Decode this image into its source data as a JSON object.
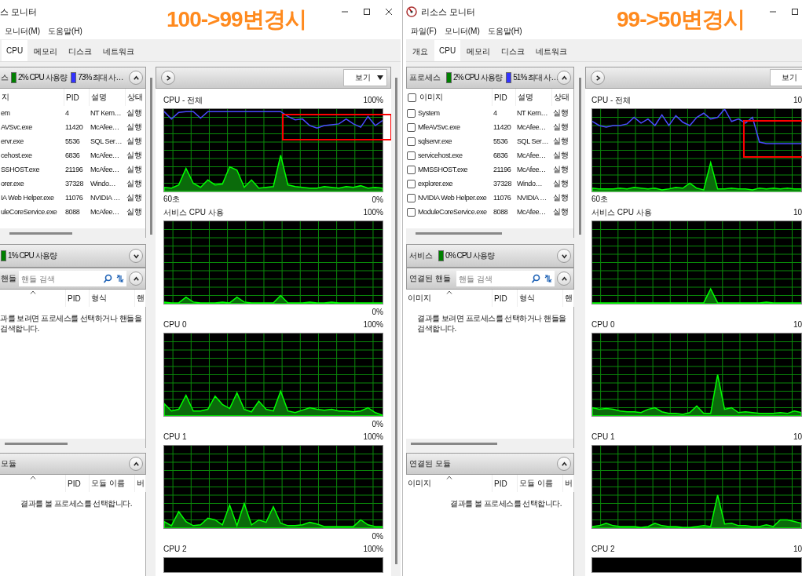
{
  "windows": [
    {
      "title": "스 모니터",
      "annotation": "100->99변경시",
      "menu": [
        "모니터(M)",
        "도움말(H)"
      ],
      "tabs": [
        {
          "label": "CPU",
          "selected": true
        },
        {
          "label": "메모리",
          "selected": false
        },
        {
          "label": "디스크",
          "selected": false
        },
        {
          "label": "네트워크",
          "selected": false
        }
      ],
      "processes": {
        "title": "스",
        "expanded": true,
        "legends": [
          {
            "text": "2% CPU 사용량",
            "color": "#008000"
          },
          {
            "text": "73% 최대 사…",
            "color": "#3333ff"
          }
        ],
        "columns": [
          {
            "label": "지"
          },
          {
            "label": "PID"
          },
          {
            "label": "설명"
          },
          {
            "label": "상태"
          }
        ],
        "rows": [
          {
            "image": "em",
            "pid": "4",
            "description": "NT Kern…",
            "status": "실행"
          },
          {
            "image": "AVSvc.exe",
            "pid": "11420",
            "description": "McAfee…",
            "status": "실행"
          },
          {
            "image": "ervr.exe",
            "pid": "5536",
            "description": "SQL Ser…",
            "status": "실행"
          },
          {
            "image": "cehost.exe",
            "pid": "6836",
            "description": "McAfee…",
            "status": "실행"
          },
          {
            "image": "SSHOST.exe",
            "pid": "21196",
            "description": "McAfee…",
            "status": "실행"
          },
          {
            "image": "orer.exe",
            "pid": "37328",
            "description": "Windo…",
            "status": "실행"
          },
          {
            "image": "IA Web Helper.exe",
            "pid": "11076",
            "description": "NVIDIA …",
            "status": "실행"
          },
          {
            "image": "uleCoreService.exe",
            "pid": "8088",
            "description": "McAfee…",
            "status": "실행"
          }
        ]
      },
      "services": {
        "expanded": false,
        "legends": [
          {
            "text": "1% CPU 사용량",
            "color": "#008000"
          }
        ]
      },
      "handles": {
        "title": "핸들",
        "expanded": true,
        "search_placeholder": "핸들 검색",
        "columns": [
          {
            "sorted": true
          },
          {
            "label": "PID",
            "sorted": false
          },
          {
            "label": "형식",
            "sorted": false
          },
          {
            "label": "핸",
            "sorted": false
          }
        ],
        "message": "과를 보려면 프로세스를 선택하거나 핸들을 검색합니다."
      },
      "modules": {
        "title": "모듈",
        "expanded": true,
        "columns": [
          {
            "sorted": true
          },
          {
            "label": "PID",
            "sorted": false
          },
          {
            "label": "모듈 이름",
            "sorted": false
          },
          {
            "label": "버",
            "sorted": false
          }
        ],
        "message": "결과를 볼 프로세스를 선택합니다."
      },
      "view_button": "보기",
      "graphs": [
        {
          "title": "CPU - 전체",
          "top_label": "100%",
          "left_label": "60초",
          "bottom_label": "0%",
          "highlight": true
        },
        {
          "title": "서비스 CPU 사용",
          "top_label": "100%",
          "bottom_label": "0%"
        },
        {
          "title": "CPU 0",
          "top_label": "100%",
          "bottom_label": "0%"
        },
        {
          "title": "CPU 1",
          "top_label": "100%",
          "bottom_label": "0%"
        },
        {
          "title": "CPU 2",
          "top_label": "100%"
        }
      ]
    },
    {
      "title": "리소스 모니터",
      "annotation": "99->50변경시",
      "menu": [
        "파일(F)",
        "모니터(M)",
        "도움말(H)"
      ],
      "tabs": [
        {
          "label": "개요",
          "selected": false
        },
        {
          "label": "CPU",
          "selected": true
        },
        {
          "label": "메모리",
          "selected": false
        },
        {
          "label": "디스크",
          "selected": false
        },
        {
          "label": "네트워크",
          "selected": false
        }
      ],
      "processes": {
        "title": "프로세스",
        "expanded": true,
        "select_all_checked": false,
        "legends": [
          {
            "text": "2% CPU 사용량",
            "color": "#008000"
          },
          {
            "text": "51% 최대 사…",
            "color": "#3333ff"
          }
        ],
        "columns": [
          {
            "label": "이미지"
          },
          {
            "label": "PID"
          },
          {
            "label": "설명"
          },
          {
            "label": "상태"
          }
        ],
        "rows": [
          {
            "checked": false,
            "image": "System",
            "pid": "4",
            "description": "NT Kern…",
            "status": "실행"
          },
          {
            "checked": false,
            "image": "MfeAVSvc.exe",
            "pid": "11420",
            "description": "McAfee…",
            "status": "실행"
          },
          {
            "checked": false,
            "image": "sqlservr.exe",
            "pid": "5536",
            "description": "SQL Ser…",
            "status": "실행"
          },
          {
            "checked": false,
            "image": "servicehost.exe",
            "pid": "6836",
            "description": "McAfee…",
            "status": "실행"
          },
          {
            "checked": false,
            "image": "MMSSHOST.exe",
            "pid": "21196",
            "description": "McAfee…",
            "status": "실행"
          },
          {
            "checked": false,
            "image": "explorer.exe",
            "pid": "37328",
            "description": "Windo…",
            "status": "실행"
          },
          {
            "checked": false,
            "image": "NVIDIA Web Helper.exe",
            "pid": "11076",
            "description": "NVIDIA …",
            "status": "실행"
          },
          {
            "checked": false,
            "image": "ModuleCoreService.exe",
            "pid": "8088",
            "description": "McAfee…",
            "status": "실행"
          }
        ]
      },
      "services": {
        "title": "서비스",
        "expanded": false,
        "legends": [
          {
            "text": "0% CPU 사용량",
            "color": "#008000"
          }
        ]
      },
      "handles": {
        "title": "연결된 핸들",
        "expanded": true,
        "search_placeholder": "핸들 검색",
        "columns": [
          {
            "label": "이미지",
            "sorted": true
          },
          {
            "label": "PID",
            "sorted": false
          },
          {
            "label": "형식",
            "sorted": false
          },
          {
            "label": "핸",
            "sorted": false
          }
        ],
        "message": "결과를 보려면 프로세스를 선택하거나 핸들을 검색합니다."
      },
      "modules": {
        "title": "연결된 모듈",
        "expanded": true,
        "columns": [
          {
            "label": "이미지",
            "sorted": true
          },
          {
            "label": "PID",
            "sorted": false
          },
          {
            "label": "모듈 이름",
            "sorted": false
          },
          {
            "label": "버",
            "sorted": false
          }
        ],
        "message": "결과를 볼 프로세스를 선택합니다."
      },
      "view_button": "보기",
      "graphs": [
        {
          "title": "CPU - 전체",
          "top_label": "10",
          "left_label": "60초",
          "highlight": true
        },
        {
          "title": "서비스 CPU 사용",
          "top_label": "10"
        },
        {
          "title": "CPU 0",
          "top_label": "10"
        },
        {
          "title": "CPU 1",
          "top_label": "10"
        },
        {
          "title": "CPU 2",
          "top_label": "10"
        }
      ]
    }
  ]
}
